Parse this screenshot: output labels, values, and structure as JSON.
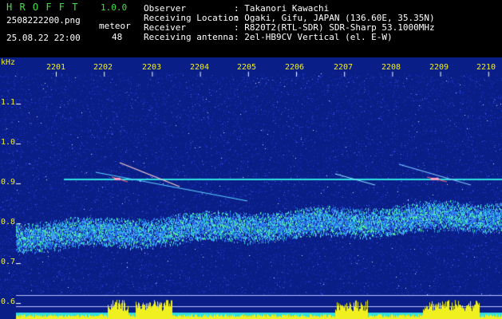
{
  "header": {
    "app_name": "H R O F F T",
    "version": "1.0.0",
    "filename": "2508222200.png",
    "datetime": "25.08.22 22:00",
    "count_label": "meteor",
    "count_value": "48",
    "fields": [
      {
        "label": "Observer",
        "value": ": Takanori Kawachi"
      },
      {
        "label": "Receiving Location",
        "value": ": Ogaki, Gifu, JAPAN (136.60E, 35.35N)"
      },
      {
        "label": "Receiver",
        "value": ": R820T2(RTL-SDR) SDR-Sharp 53.1000MHz"
      },
      {
        "label": "Receiving antenna",
        "value": ": 2el-HB9CV Vertical (el. E-W)"
      }
    ]
  },
  "axes": {
    "y_unit": "kHz",
    "y_ticks": [
      "1.1",
      "1.0",
      "0.9",
      "0.8",
      "0.7",
      "0.6"
    ],
    "x_ticks": [
      "2201",
      "2202",
      "2203",
      "2204",
      "2205",
      "2206",
      "2207",
      "2208",
      "2209",
      "2210"
    ]
  },
  "colors": {
    "background": "#000000",
    "spectrum_bg": "#0a1e88",
    "text_green": "#40e040",
    "text_white": "#ffffff",
    "text_yellow": "#f0f020",
    "signal_cyan": "#30e0e0",
    "level_yellow": "#f0f020"
  }
}
